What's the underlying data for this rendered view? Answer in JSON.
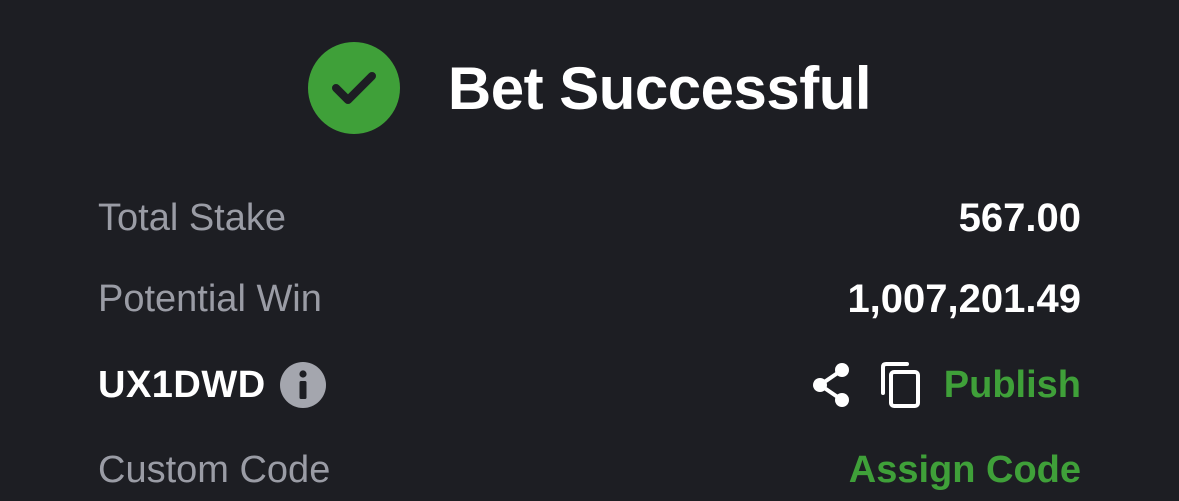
{
  "header": {
    "icon": "checkmark-circle-icon",
    "title": "Bet Successful",
    "accent_color": "#3fa039"
  },
  "summary": {
    "total_stake_label": "Total Stake",
    "total_stake_value": "567.00",
    "potential_win_label": "Potential Win",
    "potential_win_value": "1,007,201.49"
  },
  "booking": {
    "code": "UX1DWD",
    "info_icon": "info-icon",
    "share_icon": "share-icon",
    "copy_icon": "copy-icon",
    "publish_label": "Publish"
  },
  "custom_code": {
    "label": "Custom Code",
    "assign_label": "Assign Code"
  }
}
